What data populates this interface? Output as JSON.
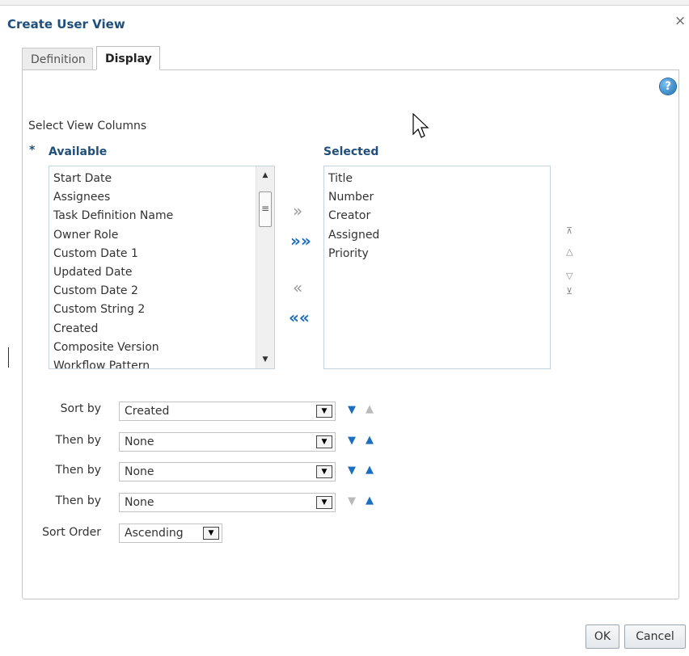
{
  "dialog": {
    "title": "Create User View",
    "close_glyph": "×",
    "tabs": [
      {
        "label": "Definition",
        "active": false
      },
      {
        "label": "Display",
        "active": true
      }
    ],
    "help_glyph": "?"
  },
  "columns": {
    "section_label": "Select View Columns",
    "required_marker": "*",
    "available_label": "Available",
    "selected_label": "Selected",
    "available": [
      "Start Date",
      "Assignees",
      "Task Definition Name",
      "Owner Role",
      "Custom Date 1",
      "Updated Date",
      "Custom Date 2",
      "Custom String 2",
      "Created",
      "Composite Version",
      "Workflow Pattern"
    ],
    "selected": [
      "Title",
      "Number",
      "Creator",
      "Assigned",
      "Priority"
    ],
    "shuttle": {
      "move": "»",
      "move_all": "»»",
      "remove": "«",
      "remove_all": "««"
    },
    "reorder": {
      "top": "⊼",
      "up": "△",
      "down": "▽",
      "bottom": "⊻"
    }
  },
  "sort": {
    "rows": [
      {
        "label": "Sort by",
        "value": "Created",
        "desc_enabled": true,
        "asc_enabled": false
      },
      {
        "label": "Then by",
        "value": "None",
        "desc_enabled": true,
        "asc_enabled": true
      },
      {
        "label": "Then by",
        "value": "None",
        "desc_enabled": true,
        "asc_enabled": true
      },
      {
        "label": "Then by",
        "value": "None",
        "desc_enabled": false,
        "asc_enabled": true
      }
    ],
    "order_label": "Sort Order",
    "order_value": "Ascending",
    "desc_glyph": "▼",
    "asc_glyph": "▲"
  },
  "buttons": {
    "ok": "OK",
    "cancel": "Cancel"
  },
  "colors": {
    "title": "#1f4f7a",
    "accent": "#1c6fbf"
  }
}
